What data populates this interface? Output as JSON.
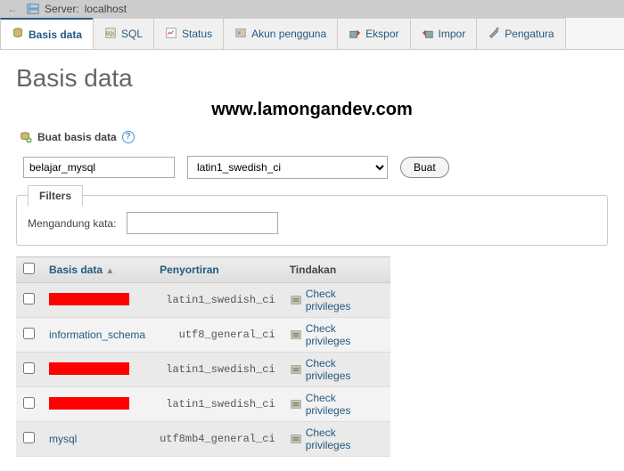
{
  "topbar": {
    "arrow": "←",
    "server_label": "Server:",
    "server_name": "localhost"
  },
  "tabs": [
    {
      "label": "Basis data",
      "active": true
    },
    {
      "label": "SQL"
    },
    {
      "label": "Status"
    },
    {
      "label": "Akun pengguna"
    },
    {
      "label": "Ekspor"
    },
    {
      "label": "Impor"
    },
    {
      "label": "Pengatura"
    }
  ],
  "page_title": "Basis data",
  "watermark": "www.lamongandev.com",
  "create": {
    "title": "Buat basis data",
    "name_value": "belajar_mysql",
    "collation_value": "latin1_swedish_ci",
    "button": "Buat"
  },
  "filters": {
    "tab": "Filters",
    "label": "Mengandung kata:",
    "value": ""
  },
  "columns": {
    "db": "Basis data",
    "sort": "Penyortiran",
    "action": "Tindakan"
  },
  "action_label": "Check privileges",
  "rows": [
    {
      "name": "",
      "redacted": true,
      "collation": "latin1_swedish_ci"
    },
    {
      "name": "information_schema",
      "redacted": false,
      "collation": "utf8_general_ci"
    },
    {
      "name": "",
      "redacted": true,
      "collation": "latin1_swedish_ci"
    },
    {
      "name": "",
      "redacted": true,
      "collation": "latin1_swedish_ci"
    },
    {
      "name": "mysql",
      "redacted": false,
      "collation": "utf8mb4_general_ci"
    }
  ]
}
